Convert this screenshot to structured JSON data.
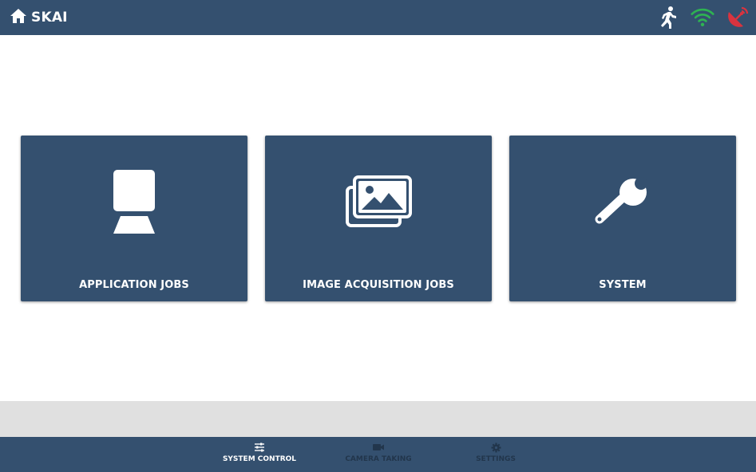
{
  "header": {
    "title": "SKAI",
    "home_icon": "home-icon",
    "status_icons": [
      "running-person-icon",
      "wifi-icon",
      "satellite-dish-icon"
    ]
  },
  "tiles": [
    {
      "label": "APPLICATION JOBS",
      "icon": "camera-device-icon"
    },
    {
      "label": "IMAGE ACQUISITION JOBS",
      "icon": "image-gallery-icon"
    },
    {
      "label": "SYSTEM",
      "icon": "wrench-icon"
    }
  ],
  "bottom_nav": {
    "items": [
      {
        "label": "SYSTEM CONTROL",
        "icon": "sliders-icon",
        "active": true
      },
      {
        "label": "CAMERA TAKING",
        "icon": "video-camera-icon",
        "active": false
      },
      {
        "label": "SETTINGS",
        "icon": "gear-icon",
        "active": false
      }
    ]
  },
  "colors": {
    "primary": "#34506f",
    "background": "#ffffff",
    "band": "#e0e0e0",
    "wifi": "#2eb352",
    "alert": "#d9333f",
    "inactive_text": "#22364c"
  }
}
